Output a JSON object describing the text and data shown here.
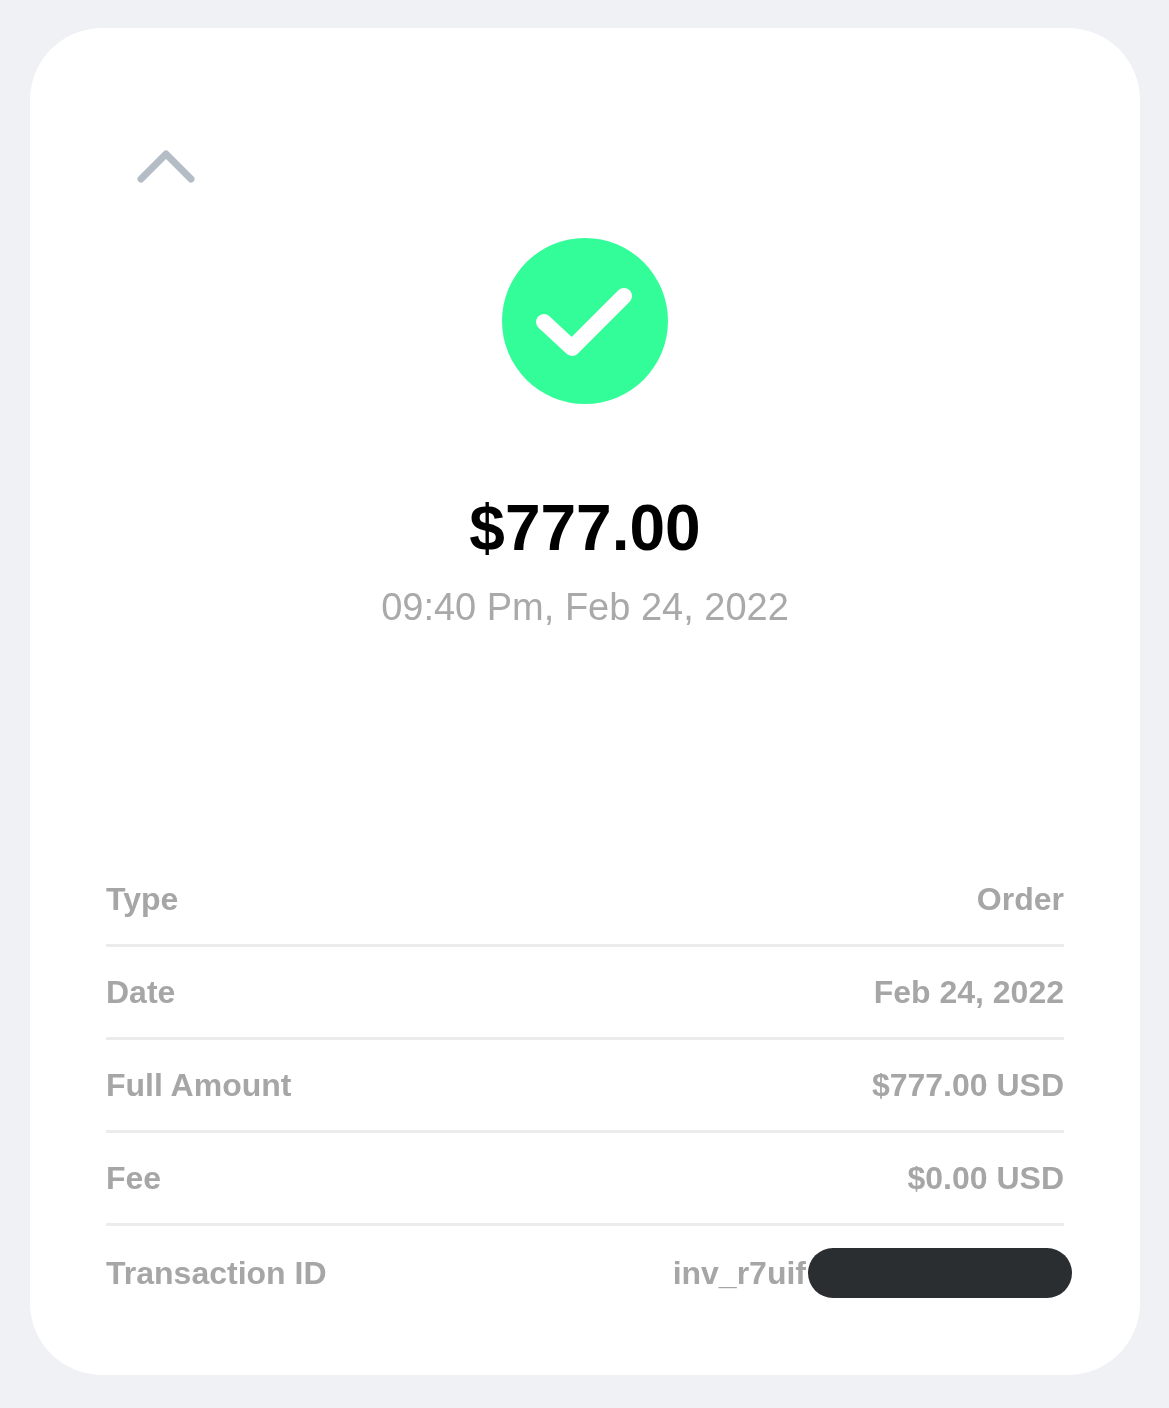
{
  "amount": "$777.00",
  "timestamp": "09:40 Pm, Feb 24, 2022",
  "details": [
    {
      "label": "Type",
      "value": "Order",
      "redacted": false
    },
    {
      "label": "Date",
      "value": "Feb 24, 2022",
      "redacted": false
    },
    {
      "label": "Full Amount",
      "value": "$777.00 USD",
      "redacted": false
    },
    {
      "label": "Fee",
      "value": "$0.00 USD",
      "redacted": false
    },
    {
      "label": "Transaction ID",
      "value": "inv_r7uif",
      "redacted": true
    }
  ]
}
